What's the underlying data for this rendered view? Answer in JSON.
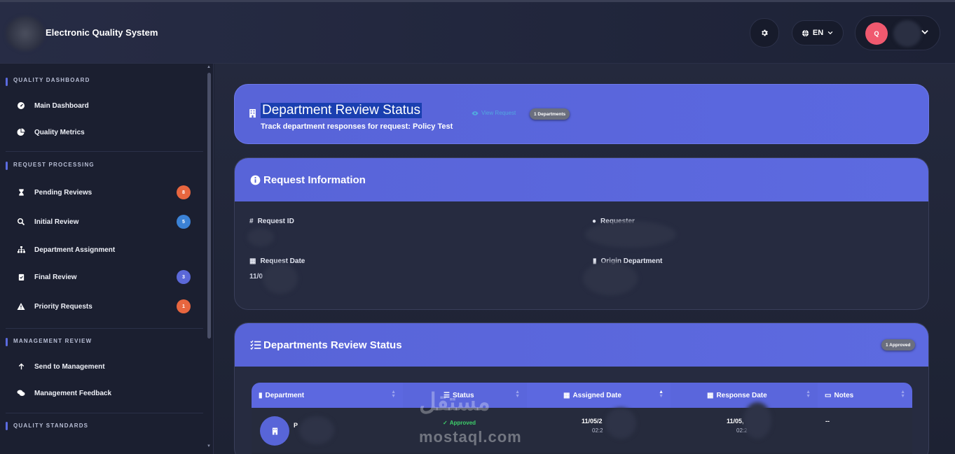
{
  "app": {
    "title": "Electronic Quality System"
  },
  "header": {
    "language": "EN",
    "avatar_initial": "Q"
  },
  "sidebar": {
    "sections": [
      {
        "label": "QUALITY DASHBOARD",
        "items": [
          {
            "label": "Main Dashboard",
            "icon": "gauge-icon"
          },
          {
            "label": "Quality Metrics",
            "icon": "pie-chart-icon"
          }
        ]
      },
      {
        "label": "REQUEST PROCESSING",
        "items": [
          {
            "label": "Pending Reviews",
            "icon": "hourglass-icon",
            "badge": "8",
            "badge_color": "#e8663f"
          },
          {
            "label": "Initial Review",
            "icon": "search-icon",
            "badge": "5",
            "badge_color": "#3b82d6"
          },
          {
            "label": "Department Assignment",
            "icon": "sitemap-icon"
          },
          {
            "label": "Final Review",
            "icon": "clipboard-check-icon",
            "badge": "3",
            "badge_color": "#5b68d8"
          },
          {
            "label": "Priority Requests",
            "icon": "warning-icon",
            "badge": "1",
            "badge_color": "#e8663f"
          }
        ]
      },
      {
        "label": "MANAGEMENT REVIEW",
        "items": [
          {
            "label": "Send to Management",
            "icon": "arrow-up-icon"
          },
          {
            "label": "Management Feedback",
            "icon": "comments-icon"
          }
        ]
      },
      {
        "label": "QUALITY STANDARDS",
        "items": []
      }
    ]
  },
  "hero": {
    "title": "Department Review Status",
    "subtitle": "Track department responses for request: Policy Test",
    "view_link": "View Request",
    "badge": "1 Departments"
  },
  "request_info": {
    "title": "Request Information",
    "fields": {
      "request_id_label": "Request ID",
      "requester_label": "Requester",
      "request_date_label": "Request Date",
      "request_date_value": "11/0",
      "origin_label": "Origin Department"
    }
  },
  "departments": {
    "title": "Departments Review Status",
    "badge": "1 Approved",
    "columns": [
      "Department",
      "Status",
      "Assigned Date",
      "Response Date",
      "Notes"
    ],
    "rows": [
      {
        "department": "P",
        "status": "Approved",
        "assigned_date": "11/05/2",
        "assigned_time": "02:2",
        "response_date": "11/05,",
        "response_time": "02:2",
        "notes": "--"
      }
    ]
  },
  "watermark": {
    "ar": "مستقل",
    "en": "mostaql.com"
  },
  "colors": {
    "accent": "#5864d8",
    "approved": "#3ecf6a"
  }
}
